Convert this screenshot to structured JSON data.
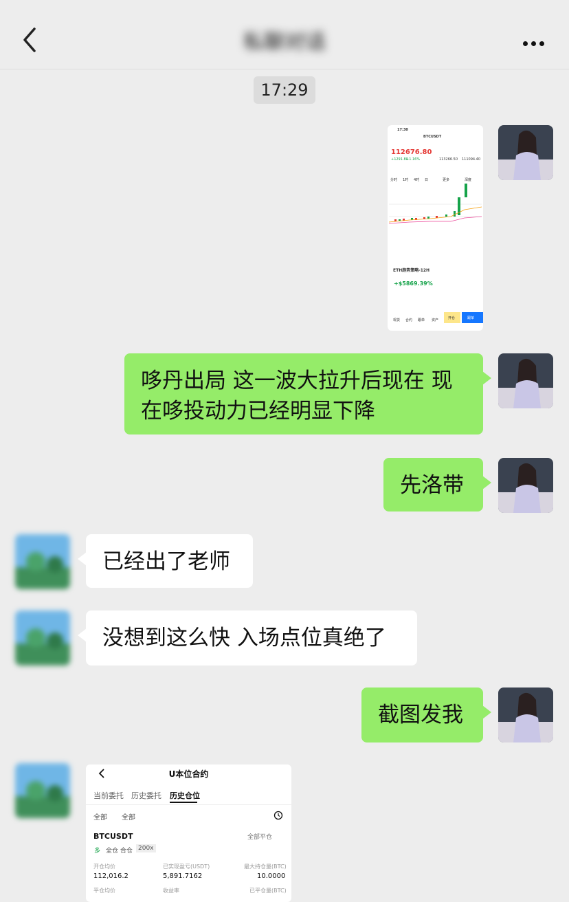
{
  "header": {
    "title": "私聊对话"
  },
  "chat": {
    "time": "17:29",
    "messages": [
      {
        "text": "哆丹出局 这一波大拉升后现在 现在哆投动力已经明显下降"
      },
      {
        "text": "先洛带"
      },
      {
        "text": "已经出了老师"
      },
      {
        "text": "没想到这么快 入场点位真绝了"
      },
      {
        "text": "截图发我"
      }
    ]
  },
  "shot1": {
    "status_time": "17:30",
    "pair": "BTCUSDT",
    "price": "112676.80",
    "change": "+1291.80",
    "change_pct": "+1.16%",
    "high": "113266.50",
    "low": "111094.40",
    "strategy_title": "ETH趋势策略-12H",
    "strategy_return": "+$5869.39%",
    "tabs": [
      "分时",
      "1时",
      "4时",
      "日",
      "更多",
      "深度"
    ],
    "bottom_tabs": [
      "现货",
      "合约",
      "跟单",
      "资产"
    ],
    "btn_open": "开仓",
    "btn_follow": "跟单"
  },
  "shot2": {
    "title": "U本位合约",
    "tabs": [
      "当前委托",
      "历史委托",
      "历史仓位"
    ],
    "filter_all_1": "全部",
    "filter_all_2": "全部",
    "symbol": "BTCUSDT",
    "close_all": "全部平仓",
    "tag_long": "多",
    "tag_margin": "全仓 合仓",
    "tag_leverage": "200x",
    "labels": [
      "开仓均价",
      "已实现盈亏(USDT)",
      "最大持仓量(BTC)"
    ],
    "values": [
      "112,016.2",
      "5,891.7162",
      "10.0000"
    ],
    "labels2": [
      "平仓均价",
      "收益率",
      "已平仓量(BTC)"
    ]
  },
  "colors": {
    "bubble_green": "#95ec69",
    "bg": "#ededed"
  }
}
